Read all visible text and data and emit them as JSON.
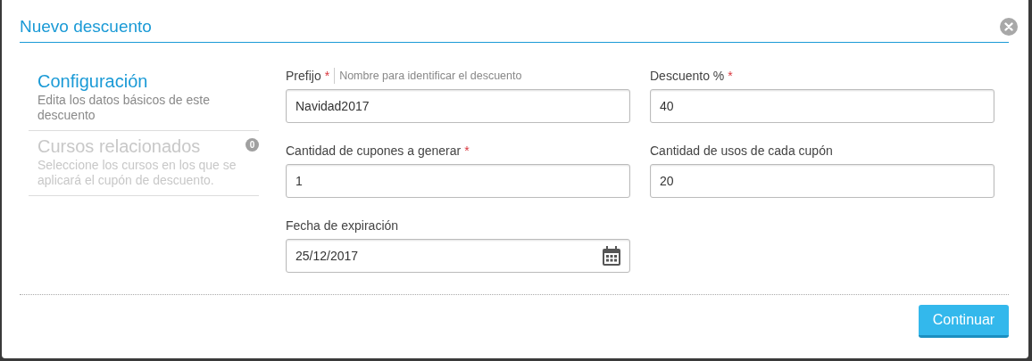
{
  "dialog": {
    "title": "Nuevo descuento"
  },
  "steps": [
    {
      "title": "Configuración",
      "description": "Edita los datos básicos de este descuento",
      "selected": true
    },
    {
      "title": "Cursos relacionados",
      "description": "Seleccione los cursos en los que se aplicará el cupón de descuento.",
      "selected": false,
      "badge": "0"
    }
  ],
  "fields": [
    {
      "kind": "text",
      "label": "Prefijo",
      "required_mark": "*",
      "hint": "Nombre para identificar el descuento",
      "value": "Navidad2017"
    },
    {
      "kind": "text",
      "label": "Descuento %",
      "required_mark": "*",
      "value": "40"
    },
    {
      "kind": "text",
      "label": "Cantidad de cupones a generar",
      "required_mark": "*",
      "value": "1"
    },
    {
      "kind": "text",
      "label": "Cantidad de usos de cada cupón",
      "value": "20"
    },
    {
      "kind": "date",
      "label": "Fecha de expiración",
      "value": "25/12/2017"
    }
  ],
  "buttons": [
    "Continuar"
  ]
}
